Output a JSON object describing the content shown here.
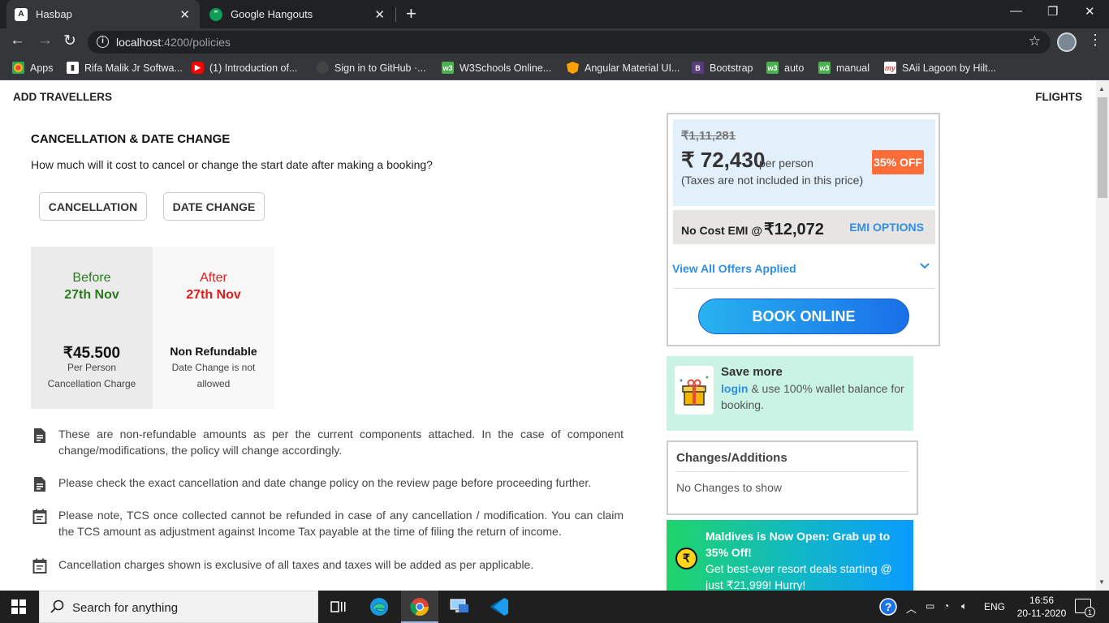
{
  "browser": {
    "tabs": [
      {
        "title": "Hasbap",
        "favicon": "A"
      },
      {
        "title": "Google Hangouts",
        "favicon": "\""
      }
    ],
    "url_host": "localhost",
    "url_path": ":4200/policies",
    "bookmarks": [
      {
        "label": "Apps",
        "icon": "apps-grid-icon",
        "color": "#e8453c"
      },
      {
        "label": "Rifa Malik Jr Softwa...",
        "icon": "bookmark-page-icon",
        "color": "#ffffff"
      },
      {
        "label": "(1) Introduction of...",
        "icon": "youtube-icon",
        "color": "#ff0000"
      },
      {
        "label": "Sign in to GitHub ·...",
        "icon": "github-icon",
        "color": "#444444"
      },
      {
        "label": "W3Schools Online...",
        "icon": "w3schools-icon",
        "color": "#4caf50"
      },
      {
        "label": "Angular Material UI...",
        "icon": "angular-material-icon",
        "color": "#ffa000"
      },
      {
        "label": "Bootstrap",
        "icon": "bootstrap-icon",
        "color": "#563d7c"
      },
      {
        "label": "auto",
        "icon": "w3schools-icon",
        "color": "#4caf50"
      },
      {
        "label": "manual",
        "icon": "w3schools-icon",
        "color": "#4caf50"
      },
      {
        "label": "SAii Lagoon by Hilt...",
        "icon": "makemytrip-icon",
        "color": "#e8453c"
      }
    ]
  },
  "page": {
    "header_left": "ADD TRAVELLERS",
    "header_right": "FLIGHTS",
    "section_title": "CANCELLATION & DATE CHANGE",
    "section_subtitle": "How much will it cost to cancel or change the start date after making a booking?",
    "tabs": {
      "cancellation": "CANCELLATION",
      "date_change": "DATE CHANGE"
    },
    "before": {
      "label": "Before",
      "date": "27th Nov",
      "amount": "₹45.500",
      "line1": "Per Person",
      "line2": "Cancellation Charge",
      "label_color": "#2a7a1f"
    },
    "after": {
      "label": "After",
      "date": "27th Nov",
      "status": "Non Refundable",
      "line1": "Date Change is not",
      "line2": "allowed",
      "label_color": "#e21b1b"
    },
    "notes": [
      {
        "text": "These are non-refundable amounts as per the current components attached. In the case of component change/modifications, the policy will change accordingly.",
        "icon": "document-icon"
      },
      {
        "text": "Please check the exact cancellation and date change policy on the review page before proceeding further.",
        "icon": "document-icon"
      },
      {
        "text": "Please note, TCS once collected cannot be refunded in case of any cancellation / modification. You can claim the TCS amount as adjustment against Income Tax payable at the time of filing the return of income.",
        "icon": "calendar-note-icon"
      },
      {
        "text": "Cancellation charges shown is exclusive of all taxes and taxes will be added as per applicable.",
        "icon": "calendar-note-icon"
      }
    ]
  },
  "pricing": {
    "original_price": "₹1,11,281",
    "price": "₹ 72,430",
    "per_person": "per person",
    "tax_note": "(Taxes are not included in this price)",
    "discount_badge": "35% OFF",
    "emi_label": "No Cost EMI @ ",
    "emi_amount": "₹12,072",
    "emi_options": "EMI OPTIONS",
    "offers_link": "View All Offers Applied",
    "book_button": "BOOK ONLINE"
  },
  "wallet": {
    "title": "Save more",
    "login_link": "login",
    "body": " & use 100% wallet balance for booking."
  },
  "changes": {
    "title": "Changes/Additions",
    "body": "No Changes to show"
  },
  "promo": {
    "coin": "₹",
    "title": "Maldives is Now Open: Grab up to 35% Off!",
    "body": "Get best-ever resort deals starting @ just ₹21,999! Hurry!"
  },
  "taskbar": {
    "search_placeholder": "Search for anything",
    "language": "ENG",
    "time": "16:56",
    "date": "20-11-2020",
    "notification_count": "1"
  }
}
